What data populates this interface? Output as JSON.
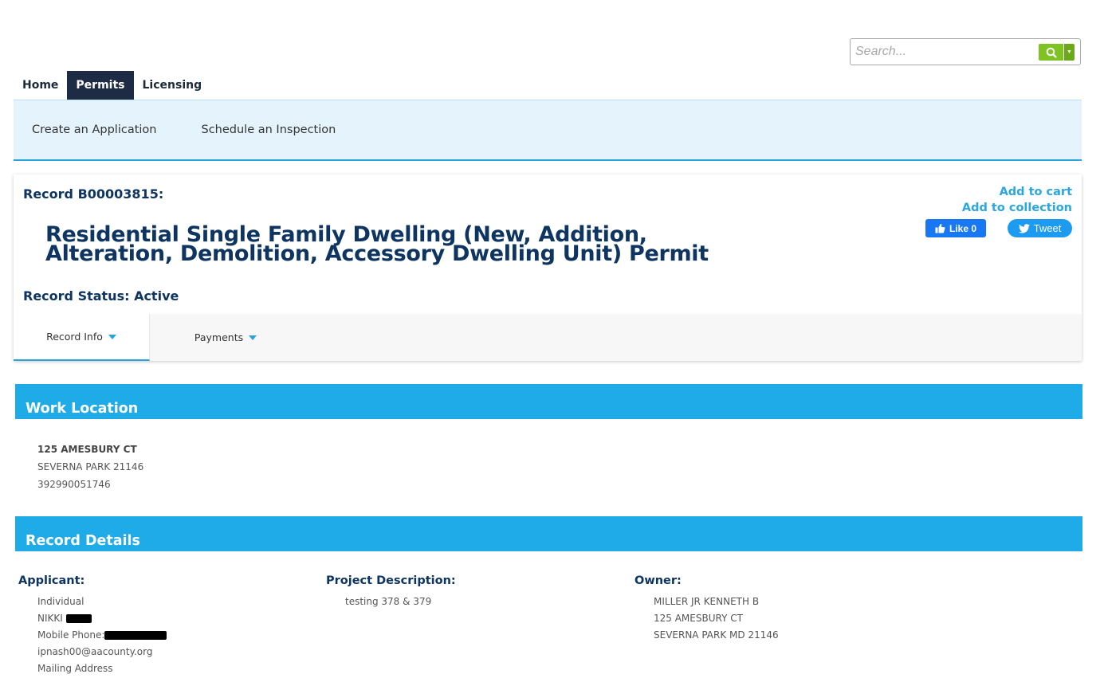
{
  "search": {
    "placeholder": "Search..."
  },
  "topnav": {
    "items": [
      {
        "label": "Home"
      },
      {
        "label": "Permits"
      },
      {
        "label": "Licensing"
      }
    ],
    "active": "Permits"
  },
  "subnav": {
    "items": [
      {
        "label": "Create an Application"
      },
      {
        "label": "Schedule an Inspection"
      }
    ]
  },
  "record": {
    "id_label": "Record B00003815:",
    "title": "Residential Single Family Dwelling (New, Addition, Alteration, Demolition, Accessory Dwelling Unit) Permit",
    "status_label": "Record Status: Active",
    "add_to_cart": "Add to cart",
    "add_to_collection": "Add to collection",
    "like_label": "Like 0",
    "tweet_label": "Tweet",
    "tabs": [
      {
        "label": "Record Info"
      },
      {
        "label": "Payments"
      }
    ]
  },
  "work_location": {
    "header": "Work Location",
    "address_line1": "125 AMESBURY CT",
    "address_line2": "SEVERNA PARK 21146",
    "parcel": "392990051746"
  },
  "record_details": {
    "header": "Record Details",
    "applicant": {
      "heading": "Applicant:",
      "type": "Individual",
      "name": "NIKKI",
      "phone_label": "Mobile Phone:",
      "email": "ipnash00@aacounty.org",
      "mailing_label": "Mailing Address"
    },
    "project_description": {
      "heading": "Project Description:",
      "text": "testing 378 & 379"
    },
    "owner": {
      "heading": "Owner:",
      "name": "MILLER JR KENNETH B",
      "address_line1": "125 AMESBURY CT",
      "address_line2": "SEVERNA PARK MD 21146"
    }
  },
  "colors": {
    "accent": "#1fabe8",
    "navy": "#0e3561",
    "subnav_bg": "#e5f4fc",
    "search_green": "#7ec322"
  }
}
